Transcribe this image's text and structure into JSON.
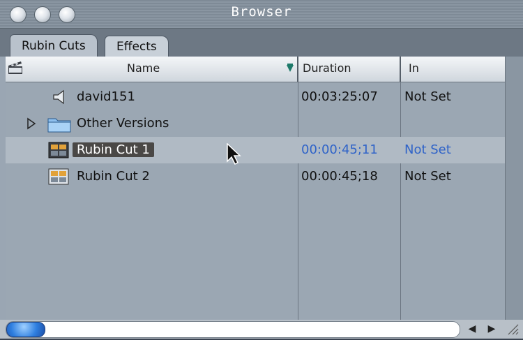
{
  "window": {
    "title": "Browser"
  },
  "tabs": [
    {
      "label": "Rubin Cuts",
      "active": true
    },
    {
      "label": "Effects",
      "active": false
    }
  ],
  "columns": {
    "name": "Name",
    "duration": "Duration",
    "in": "In"
  },
  "rows": [
    {
      "icon": "audio-clip-icon",
      "name": "david151",
      "duration": "00:03:25:07",
      "in": "Not Set",
      "selected": false
    },
    {
      "icon": "bin-folder-icon",
      "name": "Other Versions",
      "duration": "",
      "in": "",
      "selected": false,
      "expandable": true
    },
    {
      "icon": "sequence-icon",
      "name": "Rubin Cut 1",
      "duration": "00:00:45;11",
      "in": "Not Set",
      "selected": true
    },
    {
      "icon": "sequence-icon",
      "name": "Rubin Cut 2",
      "duration": "00:00:45;18",
      "in": "Not Set",
      "selected": false
    }
  ],
  "colors": {
    "selected_text": "#2f63c8",
    "accent": "#2f7fe0"
  }
}
